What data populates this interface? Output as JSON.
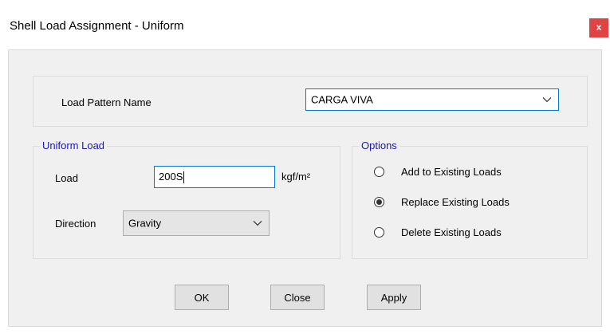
{
  "window": {
    "title": "Shell Load Assignment - Uniform",
    "close_glyph": "x",
    "close_color": "#e04343"
  },
  "load_pattern": {
    "label": "Load Pattern Name",
    "selected": "CARGA VIVA"
  },
  "uniform_load": {
    "legend": "Uniform Load",
    "load_label": "Load",
    "load_value": "200S",
    "unit": "kgf/m²",
    "direction_label": "Direction",
    "direction_value": "Gravity"
  },
  "options": {
    "legend": "Options",
    "items": [
      {
        "label": "Add to Existing Loads",
        "checked": false
      },
      {
        "label": "Replace Existing Loads",
        "checked": true
      },
      {
        "label": "Delete Existing Loads",
        "checked": false
      }
    ]
  },
  "buttons": {
    "ok": "OK",
    "close": "Close",
    "apply": "Apply"
  },
  "colors": {
    "legend_text": "#1a1aa6",
    "focus_border": "#0078d7",
    "dialog_bg": "#f0f0f0"
  }
}
